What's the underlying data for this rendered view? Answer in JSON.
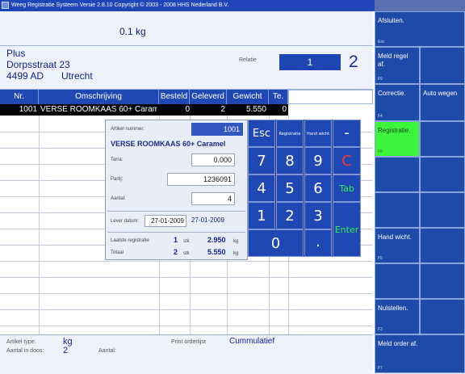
{
  "window": {
    "title": "Weeg Registratie Systeem Versie 2.8.10  Copyright © 2003 - 2008 HHS Nederland B.V."
  },
  "scale": {
    "weight_display": "0.1 kg"
  },
  "customer": {
    "name": "Plus",
    "street": "Dorpsstraat 23",
    "postcode": "4499 AD",
    "city": "Utrecht",
    "relatie_label": "Relatie",
    "relatie_value": "1",
    "relatie_count": "2"
  },
  "grid": {
    "columns": [
      "Nr.",
      "Omschrijving",
      "Besteld",
      "Geleverd",
      "Gewicht",
      "Te."
    ],
    "rows": [
      {
        "nr": "1001",
        "omschrijving": "VERSE ROOMKAAS 60+ Caram",
        "besteld": "0",
        "geleverd": "2",
        "gewicht": "5.550",
        "te": "0"
      }
    ]
  },
  "dialog": {
    "artikel_label": "Artikel nummer:",
    "artikel_value": "1001",
    "product_name": "VERSE ROOMKAAS 60+ Caramel",
    "tarra_label": "Tarra:",
    "tarra_value": "0.000",
    "partij_label": "Partij:",
    "partij_value": "1236091",
    "aantal_label": "Aantal:",
    "aantal_value": "4",
    "lever_label": "Lever datum:",
    "lever_value": "27-01-2009",
    "lever_value2": "27-01-2009",
    "laatste_label": "Laatste registratie",
    "laatste_count": "1",
    "laatste_unit": "stk",
    "laatste_weight": "2.950",
    "laatste_kg": "kg",
    "totaal_label": "Totaal",
    "totaal_count": "2",
    "totaal_unit": "stk",
    "totaal_weight": "5.550",
    "totaal_kg": "kg"
  },
  "keypad": {
    "esc": "Esc",
    "registratie": "Registratie",
    "handwicht": "Hand wicht",
    "minus": "-",
    "k7": "7",
    "k8": "8",
    "k9": "9",
    "clear": "C",
    "k4": "4",
    "k5": "5",
    "k6": "6",
    "tab": "Tab",
    "k1": "1",
    "k2": "2",
    "k3": "3",
    "enter": "Enter",
    "k0": "0",
    "dot": ".",
    "colors": {
      "clear": "#ff3333",
      "tab": "#33ee55",
      "enter": "#33ee55"
    }
  },
  "bottom": {
    "artikel_type_label": "Artikel type:",
    "artikel_type_value": "kg",
    "aantal_doos_label": "Aantal in doos:",
    "aantal_doos_value": "2",
    "aantal_label": "Aantal:",
    "print_label": "Print orderlijst",
    "print_value": "Cummulatief"
  },
  "function_keys": {
    "afsluiten": "Afsluiten.",
    "afsluiten_key": "Esc",
    "meld_regel_1": "Meld regel",
    "meld_regel_2": "af.",
    "meld_regel_key": "F9",
    "correctie": "Correctie.",
    "correctie_key": "F4",
    "auto_wegen": "Auto wegen",
    "registratie": "Registratie.",
    "registratie_key": "F8",
    "hand_wicht": "Hand wicht.",
    "hand_wicht_key": "F5",
    "nulstellen": "Nulstellen.",
    "nulstellen_key": "F3",
    "meld_order": "Meld order af.",
    "meld_order_key": "F7"
  },
  "colors": {
    "accent": "#1f48b4",
    "active_key": "#3ef53e"
  }
}
